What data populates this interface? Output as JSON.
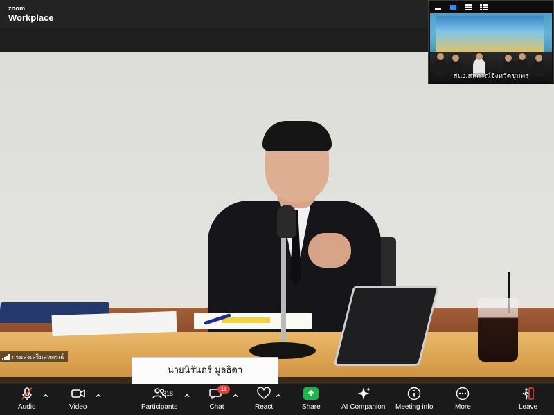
{
  "app": {
    "brand_top": "zoom",
    "brand_bottom": "Workplace"
  },
  "main_video": {
    "nameplate_text": "นายนิรันดร์ มูลธิดา",
    "participant_name": "กรมส่งเสริมสหกรณ์"
  },
  "self_view": {
    "caption": "สนง.สหกรณ์จังหวัดชุมพร",
    "controls": [
      "minimize-icon",
      "speaker-view-icon",
      "strip-view-icon",
      "gallery-view-icon"
    ]
  },
  "toolbar": {
    "audio_label": "Audio",
    "video_label": "Video",
    "participants_label": "Participants",
    "participants_count": "318",
    "chat_label": "Chat",
    "chat_unread": "11",
    "react_label": "React",
    "share_label": "Share",
    "ai_label": "AI Companion",
    "info_label": "Meeting info",
    "more_label": "More",
    "leave_label": "Leave"
  },
  "colors": {
    "share_green": "#20b34b",
    "leave_red": "#e0423b",
    "muted_red": "#e0423b",
    "badge_red": "#e0423b"
  }
}
